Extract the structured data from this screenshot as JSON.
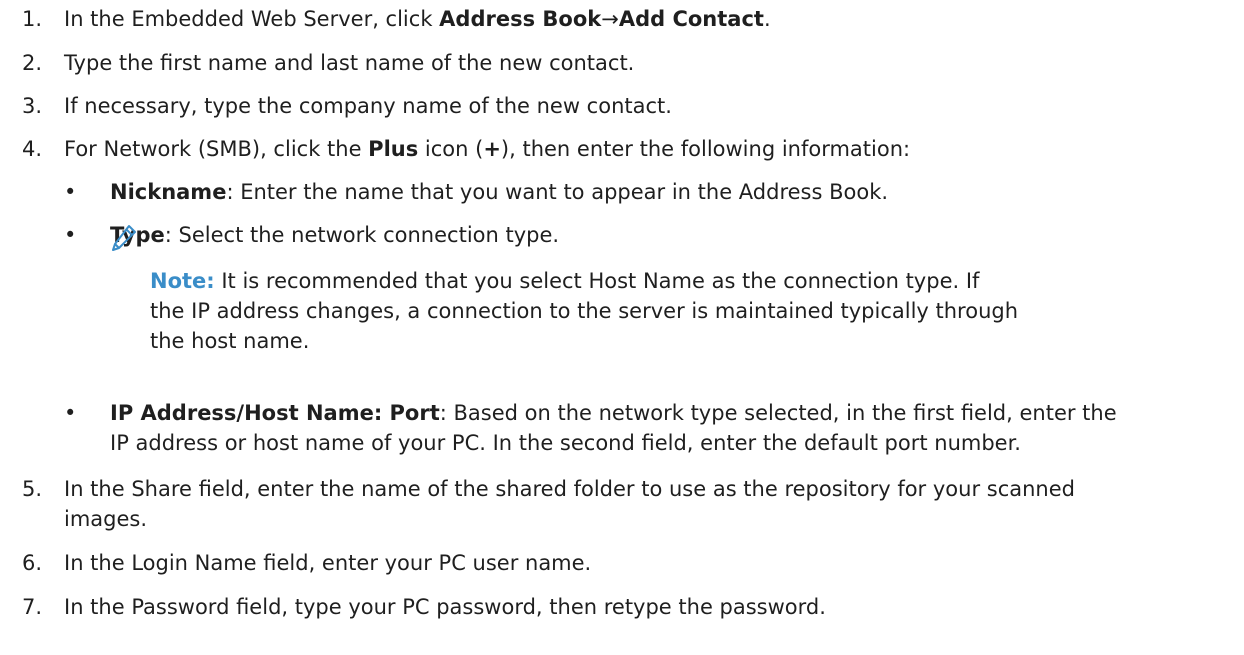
{
  "steps": [
    {
      "num": "1.",
      "pre": "In the Embedded Web Server, click ",
      "bold1": "Address Book",
      "arrow": "→",
      "bold2": "Add Contact",
      "post": "."
    },
    {
      "num": "2.",
      "text": "Type the first name and last name of the new contact."
    },
    {
      "num": "3.",
      "text": "If necessary, type the company name of the new contact."
    },
    {
      "num": "4.",
      "pre": "For Network (SMB), click the ",
      "bold": "Plus",
      "mid": " icon (",
      "plus": "+",
      "post": "), then enter the following information:"
    },
    {
      "num": "5.",
      "line1": "In the Share field, enter the name of the shared folder to use as the repository for your scanned",
      "line2": "images."
    },
    {
      "num": "6.",
      "text": "In the Login Name field, enter your PC user name."
    },
    {
      "num": "7.",
      "text": "In the Password field, type your PC password, then retype the password."
    }
  ],
  "bullets": [
    {
      "label": "Nickname",
      "text": ": Enter the name that you want to appear in the Address Book."
    },
    {
      "label": "Type",
      "text": ": Select the network connection type."
    },
    {
      "label": "IP Address/Host Name: Port",
      "text": ": Based on the network type selected, in the first field, enter the",
      "line2": "IP address or host name of your PC. In the second field, enter the default port number."
    }
  ],
  "bullet_symbol": "•",
  "note": {
    "icon": "pencil-icon",
    "label": "Note:",
    "line1": " It is recommended that you select Host Name as the connection type. If",
    "line2": "the IP address changes, a connection to the server is maintained typically through",
    "line3": "the host name."
  },
  "colors": {
    "note_label": "#3a8dc8",
    "icon": "#3a8dc8",
    "text": "#1f1f1f"
  }
}
